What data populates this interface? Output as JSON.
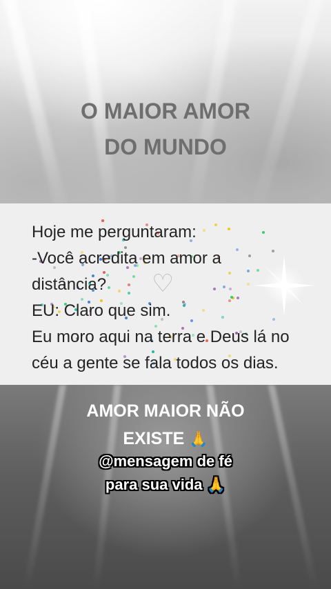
{
  "header": {
    "title_line1": "O MAIOR AMOR",
    "title_line2": "DO MUNDO"
  },
  "card": {
    "line1": "Hoje me perguntaram:",
    "line2_words": [
      "-Você",
      "acredita",
      "em",
      "amor",
      "a"
    ],
    "line3": "distância?",
    "line4": "EU: Claro que sim.",
    "line5": "Eu moro aqui na terra e Deus lá no",
    "line6": "céu a gente se fala todos os dias."
  },
  "footer": {
    "line1": "AMOR MAIOR NÃO",
    "line2": "EXISTE",
    "handle_line1": "@mensagem de fé",
    "handle_line2": "para sua vida",
    "emoji": "🙏"
  },
  "colors": {
    "title": "#6e6e6e",
    "card_text": "#232323",
    "card_bg": "#efefef",
    "footer_text": "#ffffff"
  }
}
